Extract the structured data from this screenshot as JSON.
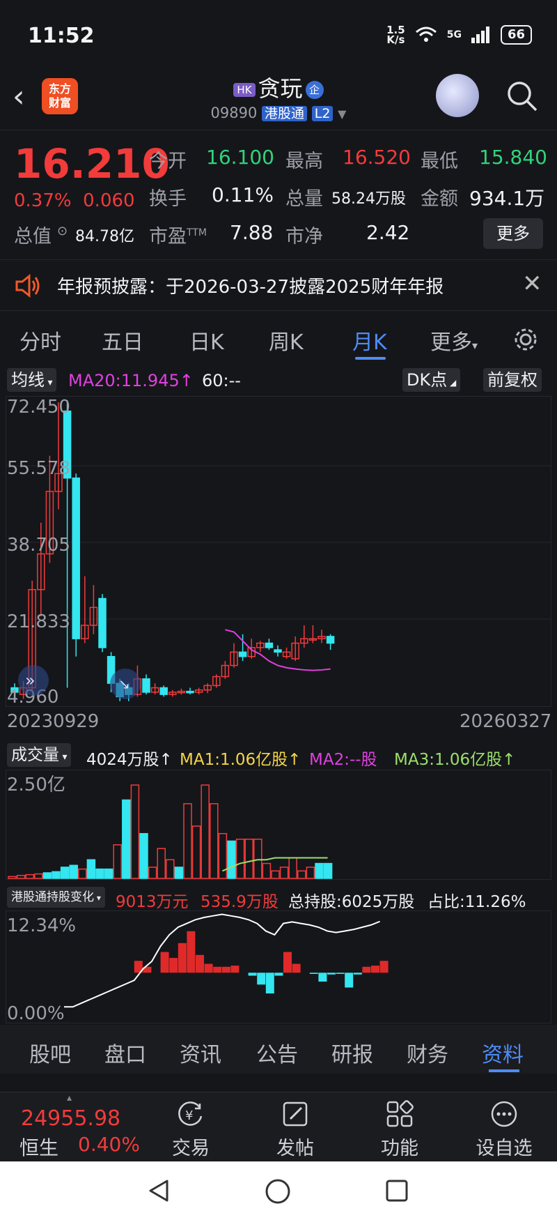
{
  "status": {
    "time": "11:52",
    "net_speed_top": "1.5",
    "net_speed_unit": "K/s",
    "signal": "5G",
    "battery": "66"
  },
  "header": {
    "hk_tag": "HK",
    "name": "贪玩",
    "qi": "企",
    "code": "09890",
    "connect": "港股通",
    "level": "L2",
    "logo_line1": "东方",
    "logo_line2": "财富"
  },
  "quote": {
    "price": "16.210",
    "change_pct": "0.37%",
    "change": "0.060",
    "open_label": "今开",
    "open": "16.100",
    "high_label": "最高",
    "high": "16.520",
    "low_label": "最低",
    "low": "15.840",
    "turnover_label": "换手",
    "turnover": "0.11%",
    "volume_label": "总量",
    "volume": "58.24万股",
    "amount_label": "金额",
    "amount": "934.1万",
    "mktcap_label": "总值",
    "mktcap": "84.78亿",
    "pe_label": "市盈",
    "pe_sup": "TTM",
    "pe": "7.88",
    "pb_label": "市净",
    "pb": "2.42",
    "more": "更多"
  },
  "notice": {
    "text": "年报预披露：于2026-03-27披露2025财年年报"
  },
  "tabs": [
    "分时",
    "五日",
    "日K",
    "周K",
    "月K",
    "更多"
  ],
  "active_tab": "月K",
  "kline": {
    "ma_button": "均线",
    "ma20": "MA20:11.945↑",
    "ma60": "60:--",
    "dk_button": "DK点",
    "adjust_button": "前复权",
    "y_labels": [
      "72.450",
      "55.578",
      "38.705",
      "21.833",
      "4.960"
    ],
    "date_start": "20230929",
    "date_end": "20260327"
  },
  "volume": {
    "button": "成交量",
    "value": "4024万股↑",
    "ma1": "MA1:1.06亿股↑",
    "ma2": "MA2:--股",
    "ma3": "MA3:1.06亿股↑",
    "y_label": "2.50亿"
  },
  "hkhold": {
    "button": "港股通持股变化",
    "v1": "9013万元",
    "v2": "535.9万股",
    "total": "总持股:6025万股",
    "ratio": "占比:11.26%",
    "y_top": "12.34%",
    "y_bottom": "0.00%"
  },
  "info_tabs": [
    "股吧",
    "盘口",
    "资讯",
    "公告",
    "研报",
    "财务",
    "资料"
  ],
  "active_info_tab": "资料",
  "bottom": {
    "index_value": "24955.98",
    "index_name": "恒生",
    "index_pct": "0.40%",
    "nav": [
      "交易",
      "发帖",
      "功能",
      "设自选"
    ]
  },
  "colors": {
    "up": "#f23b3b",
    "down": "#33e6f0",
    "accent": "#4e8cf5",
    "ma20": "#e040e0",
    "ma_vol": "#9be06a"
  },
  "chart_data": [
    {
      "type": "candlestick",
      "title": "月K",
      "ylim": [
        4.96,
        72.45
      ],
      "x_range": [
        "20230929",
        "20260327"
      ],
      "candles": [
        {
          "o": 8.0,
          "c": 7.0,
          "h": 9.0,
          "l": 6.0
        },
        {
          "o": 6.5,
          "c": 8.0,
          "h": 9.5,
          "l": 5.5
        },
        {
          "o": 8.0,
          "c": 30.0,
          "h": 32.0,
          "l": 7.0
        },
        {
          "o": 30.0,
          "c": 38.0,
          "h": 45.0,
          "l": 24.0
        },
        {
          "o": 38.0,
          "c": 52.0,
          "h": 60.0,
          "l": 36.0
        },
        {
          "o": 52.0,
          "c": 56.0,
          "h": 72.0,
          "l": 48.0
        },
        {
          "o": 70.0,
          "c": 55.0,
          "h": 72.45,
          "l": 8.0
        },
        {
          "o": 55.0,
          "c": 19.0,
          "h": 56.0,
          "l": 15.0
        },
        {
          "o": 19.0,
          "c": 22.0,
          "h": 33.0,
          "l": 18.0
        },
        {
          "o": 22.0,
          "c": 26.0,
          "h": 31.0,
          "l": 20.0
        },
        {
          "o": 28.0,
          "c": 17.0,
          "h": 29.0,
          "l": 16.0
        },
        {
          "o": 15.0,
          "c": 9.0,
          "h": 16.0,
          "l": 7.0
        },
        {
          "o": 9.0,
          "c": 6.0,
          "h": 10.0,
          "l": 5.0
        },
        {
          "o": 8.0,
          "c": 6.5,
          "h": 9.0,
          "l": 5.0
        },
        {
          "o": 6.5,
          "c": 10.0,
          "h": 13.0,
          "l": 6.0
        },
        {
          "o": 10.0,
          "c": 7.0,
          "h": 11.0,
          "l": 6.5
        },
        {
          "o": 7.0,
          "c": 8.0,
          "h": 9.0,
          "l": 6.5
        },
        {
          "o": 8.0,
          "c": 6.5,
          "h": 8.5,
          "l": 6.0
        },
        {
          "o": 6.5,
          "c": 7.0,
          "h": 7.5,
          "l": 6.0
        },
        {
          "o": 7.0,
          "c": 7.2,
          "h": 7.8,
          "l": 6.5
        },
        {
          "o": 7.2,
          "c": 7.0,
          "h": 8.0,
          "l": 6.5
        },
        {
          "o": 7.0,
          "c": 7.5,
          "h": 8.0,
          "l": 6.5
        },
        {
          "o": 7.5,
          "c": 8.5,
          "h": 9.0,
          "l": 6.8
        },
        {
          "o": 8.5,
          "c": 10.5,
          "h": 11.0,
          "l": 8.0
        },
        {
          "o": 10.5,
          "c": 13.0,
          "h": 14.0,
          "l": 10.0
        },
        {
          "o": 13.0,
          "c": 16.0,
          "h": 18.0,
          "l": 12.5
        },
        {
          "o": 16.0,
          "c": 15.0,
          "h": 20.0,
          "l": 14.0
        },
        {
          "o": 15.0,
          "c": 17.0,
          "h": 19.0,
          "l": 14.5
        },
        {
          "o": 17.0,
          "c": 18.0,
          "h": 18.5,
          "l": 16.0
        },
        {
          "o": 18.0,
          "c": 17.0,
          "h": 19.0,
          "l": 16.5
        },
        {
          "o": 16.5,
          "c": 16.0,
          "h": 17.5,
          "l": 15.0
        },
        {
          "o": 15.0,
          "c": 16.0,
          "h": 17.0,
          "l": 14.5
        },
        {
          "o": 14.5,
          "c": 18.0,
          "h": 19.5,
          "l": 14.0
        },
        {
          "o": 18.0,
          "c": 19.0,
          "h": 22.0,
          "l": 17.0
        },
        {
          "o": 19.0,
          "c": 19.0,
          "h": 22.0,
          "l": 18.0
        },
        {
          "o": 19.0,
          "c": 19.5,
          "h": 21.0,
          "l": 18.0
        },
        {
          "o": 19.5,
          "c": 18.0,
          "h": 20.0,
          "l": 16.5
        }
      ],
      "ma20": [
        null,
        null,
        null,
        null,
        null,
        null,
        null,
        null,
        null,
        null,
        null,
        null,
        null,
        null,
        null,
        null,
        null,
        null,
        null,
        null,
        null,
        null,
        null,
        null,
        21.0,
        20.5,
        18.5,
        16.5,
        15.5,
        14.0,
        13.0,
        12.5,
        12.2,
        12.0,
        11.9,
        12.0,
        12.2
      ]
    },
    {
      "type": "bar",
      "title": "成交量",
      "ylim": [
        0,
        2.8
      ],
      "y_unit": "亿股",
      "values": [
        0.05,
        0.08,
        0.1,
        0.12,
        0.15,
        0.18,
        0.3,
        0.35,
        0.25,
        0.5,
        0.25,
        0.25,
        0.9,
        2.1,
        2.5,
        1.2,
        0.3,
        0.8,
        0.5,
        0.3,
        2.0,
        1.4,
        2.5,
        2.0,
        1.2,
        1.0,
        1.05,
        1.05,
        1.05,
        0.4,
        0.2,
        0.3,
        0.55,
        0.2,
        0.3,
        0.4,
        0.4
      ],
      "up": [
        true,
        true,
        true,
        true,
        false,
        false,
        false,
        false,
        true,
        false,
        false,
        false,
        true,
        false,
        true,
        false,
        true,
        true,
        true,
        false,
        true,
        true,
        true,
        true,
        true,
        false,
        true,
        true,
        true,
        true,
        true,
        true,
        true,
        true,
        true,
        false,
        false
      ],
      "ma": [
        null,
        null,
        null,
        null,
        null,
        null,
        null,
        null,
        null,
        null,
        null,
        null,
        null,
        null,
        null,
        null,
        null,
        null,
        null,
        null,
        null,
        null,
        null,
        null,
        0.2,
        0.3,
        0.4,
        0.45,
        0.5,
        0.5,
        0.55,
        0.55,
        0.55,
        0.55,
        0.55,
        0.55,
        0.55
      ]
    },
    {
      "type": "bar",
      "title": "港股通持股变化",
      "ylim": [
        -2.0,
        12.34
      ],
      "values": [
        0,
        0,
        0,
        0,
        0,
        0,
        0,
        0,
        2.0,
        1.0,
        0,
        3.5,
        2.5,
        5.0,
        7.0,
        3.0,
        1.5,
        1.0,
        1.0,
        1.2,
        0,
        -0.5,
        -2.0,
        -3.5,
        -0.5,
        3.5,
        1.5,
        0,
        -0.2,
        -1.5,
        -0.3,
        -0.2,
        -2.5,
        -0.3,
        1.0,
        1.2,
        2.0
      ],
      "holding_line": [
        0,
        0,
        0.5,
        1.0,
        1.5,
        2.0,
        2.5,
        3.0,
        3.5,
        5.0,
        6.0,
        8.0,
        9.5,
        10.5,
        11.0,
        11.5,
        11.8,
        12.0,
        12.2,
        12.0,
        11.8,
        11.5,
        11.0,
        10.0,
        9.5,
        11.0,
        11.2,
        11.0,
        10.8,
        10.5,
        10.0,
        9.8,
        10.0,
        10.2,
        10.5,
        10.8,
        11.26
      ]
    }
  ]
}
